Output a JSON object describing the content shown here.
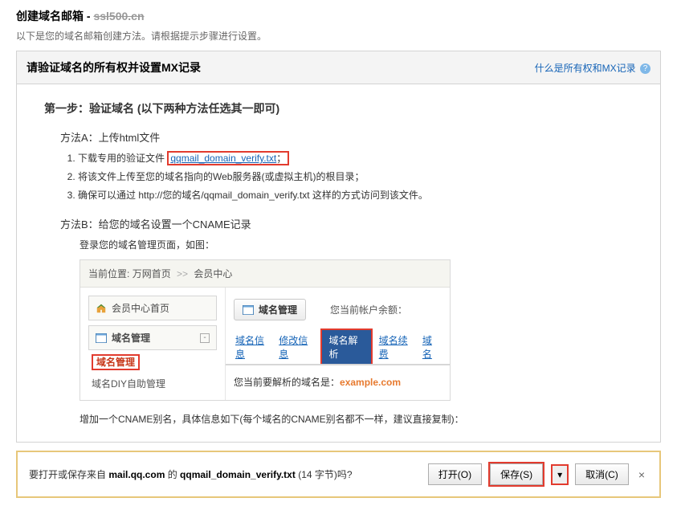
{
  "header": {
    "title_prefix": "创建域名邮箱 - ",
    "title_domain": "ssl500.cn",
    "subtitle": "以下是您的域名邮箱创建方法。请根据提示步骤进行设置。"
  },
  "panel": {
    "title": "请验证域名的所有权并设置MX记录",
    "help_text": "什么是所有权和MX记录",
    "help_icon": "?"
  },
  "step": {
    "title": "第一步：验证域名 (以下两种方法任选其一即可)",
    "methodA": {
      "title": "方法A：上传html文件",
      "li1_pre": "下载专用的验证文件",
      "li1_link": "qqmail_domain_verify.txt",
      "li1_suffix": "；",
      "li2": "将该文件上传至您的域名指向的Web服务器(或虚拟主机)的根目录；",
      "li3": "确保可以通过 http://您的域名/qqmail_domain_verify.txt 这样的方式访问到该文件。"
    },
    "methodB": {
      "title": "方法B：给您的域名设置一个CNAME记录",
      "sub": "登录您的域名管理页面，如图："
    }
  },
  "screenshot": {
    "breadcrumb": {
      "loc_label": "当前位置:",
      "home": "万网首页",
      "sep": ">>",
      "center": "会员中心"
    },
    "sidebar": {
      "home": "会员中心首页",
      "domain": "域名管理",
      "domain_sub": "域名管理",
      "diy": "域名DIY自助管理"
    },
    "main": {
      "dm_btn": "域名管理",
      "balance_label": "您当前帐户余额：",
      "tabs": [
        "域名信息",
        "修改信息",
        "域名解析",
        "域名续费",
        "域名"
      ],
      "resolve_pre": "您当前要解析的域名是：",
      "resolve_domain": "example.com"
    }
  },
  "cname_note": "增加一个CNAME别名，具体信息如下(每个域名的CNAME别名都不一样，建议直接复制)：",
  "download": {
    "text_pre": "要打开或保存来自 ",
    "host": "mail.qq.com",
    "text_mid": " 的 ",
    "filename": "qqmail_domain_verify.txt",
    "size": " (14 字节)吗?",
    "open": "打开(O)",
    "save": "保存(S)",
    "cancel": "取消(C)",
    "close": "×"
  }
}
